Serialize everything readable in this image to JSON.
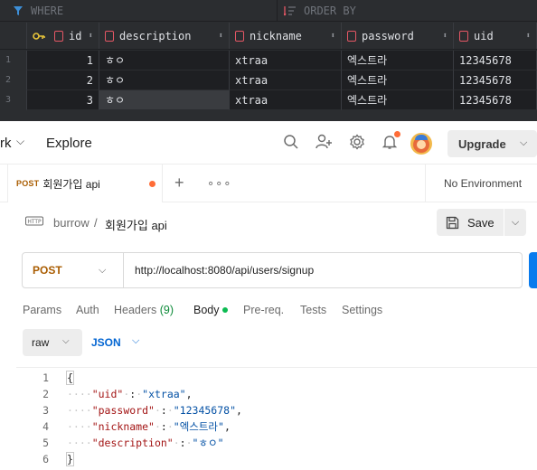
{
  "db": {
    "where_label": "WHERE",
    "order_label": "ORDER BY",
    "columns": [
      "id",
      "description",
      "nickname",
      "password",
      "uid"
    ],
    "rows": [
      {
        "num": "1",
        "id": "1",
        "description": "ㅎㅇ",
        "nickname": "xtraa",
        "password": "엑스트라",
        "uid": "12345678"
      },
      {
        "num": "2",
        "id": "2",
        "description": "ㅎㅇ",
        "nickname": "xtraa",
        "password": "엑스트라",
        "uid": "12345678"
      },
      {
        "num": "3",
        "id": "3",
        "description": "ㅎㅇ",
        "nickname": "xtraa",
        "password": "엑스트라",
        "uid": "12345678"
      }
    ]
  },
  "topbar": {
    "workspace": "rk",
    "explore": "Explore",
    "upgrade": "Upgrade"
  },
  "tab": {
    "method": "POST",
    "name": "회원가입 api",
    "environment": "No Environment"
  },
  "breadcrumb": {
    "collection": "burrow",
    "separator": "/",
    "request": "회원가입 api",
    "save": "Save"
  },
  "request": {
    "method": "POST",
    "url": "http://localhost:8080/api/users/signup"
  },
  "req_tabs": {
    "params": "Params",
    "auth": "Auth",
    "headers": "Headers",
    "headers_count": "(9)",
    "body": "Body",
    "prereq": "Pre-req.",
    "tests": "Tests",
    "settings": "Settings"
  },
  "body_mode": {
    "raw": "raw",
    "format": "JSON"
  },
  "editor": {
    "line_numbers": [
      "1",
      "2",
      "3",
      "4",
      "5",
      "6"
    ],
    "open_brace": "{",
    "close_brace": "}",
    "fields": [
      {
        "key": "\"uid\"",
        "value": "\"xtraa\"",
        "comma": ","
      },
      {
        "key": "\"password\"",
        "value": "\"12345678\"",
        "comma": ","
      },
      {
        "key": "\"nickname\"",
        "value": "\"엑스트라\"",
        "comma": ","
      },
      {
        "key": "\"description\"",
        "value": "\"ㅎㅇ\"",
        "comma": ""
      }
    ]
  }
}
